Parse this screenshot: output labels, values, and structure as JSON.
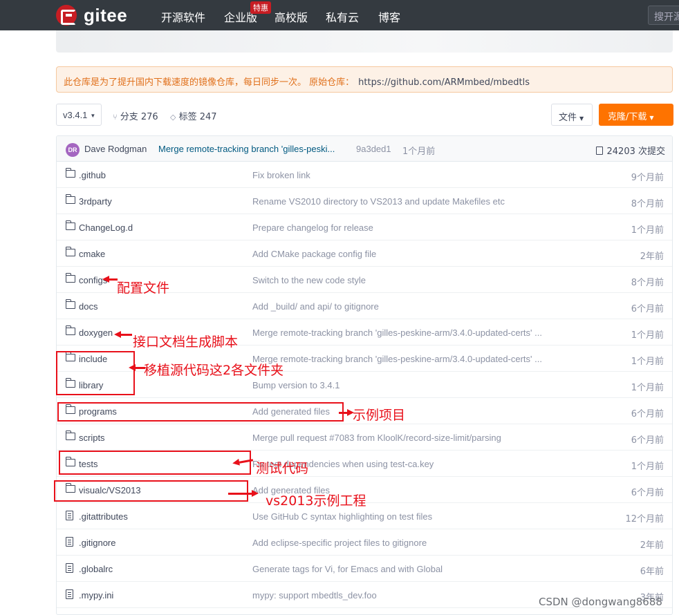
{
  "nav": {
    "logo_text": "gitee",
    "items": [
      "开源软件",
      "企业版",
      "高校版",
      "私有云",
      "博客"
    ],
    "badge": "特惠",
    "search_placeholder": "搜开源"
  },
  "notice": {
    "text": "此仓库是为了提升国内下载速度的镜像仓库，每日同步一次。 原始仓库：",
    "url": "https://github.com/ARMmbed/mbedtls"
  },
  "toolbar": {
    "version": "v3.4.1",
    "branches": "分支 276",
    "tags": "标签 247",
    "file_button": "文件",
    "clone_button": "克隆/下载"
  },
  "last_commit": {
    "avatar": "DR",
    "author": "Dave Rodgman",
    "message": "Merge remote-tracking branch 'gilles-peski...",
    "sha": "9a3ded1",
    "time": "1个月前",
    "count": "24203 次提交"
  },
  "files": [
    {
      "type": "folder",
      "name": ".github",
      "message": "Fix broken link",
      "time": "9个月前"
    },
    {
      "type": "folder",
      "name": "3rdparty",
      "message": "Rename VS2010 directory to VS2013 and update Makefiles etc",
      "time": "8个月前"
    },
    {
      "type": "folder",
      "name": "ChangeLog.d",
      "message": "Prepare changelog for release",
      "time": "1个月前"
    },
    {
      "type": "folder",
      "name": "cmake",
      "message": "Add CMake package config file",
      "time": "2年前"
    },
    {
      "type": "folder",
      "name": "configs",
      "message": "Switch to the new code style",
      "time": "8个月前"
    },
    {
      "type": "folder",
      "name": "docs",
      "message": "Add _build/ and api/ to gitignore",
      "time": "6个月前"
    },
    {
      "type": "folder",
      "name": "doxygen",
      "message": "Merge remote-tracking branch 'gilles-peskine-arm/3.4.0-updated-certs' ...",
      "time": "1个月前"
    },
    {
      "type": "folder",
      "name": "include",
      "message": "Merge remote-tracking branch 'gilles-peskine-arm/3.4.0-updated-certs' ...",
      "time": "1个月前"
    },
    {
      "type": "folder",
      "name": "library",
      "message": "Bump version to 3.4.1",
      "time": "1个月前"
    },
    {
      "type": "folder",
      "name": "programs",
      "message": "Add generated files",
      "time": "6个月前"
    },
    {
      "type": "folder",
      "name": "scripts",
      "message": "Merge pull request #7083 from KloolK/record-size-limit/parsing",
      "time": "6个月前"
    },
    {
      "type": "folder",
      "name": "tests",
      "message": "Fix test dependencies when using test-ca.key",
      "time": "1个月前"
    },
    {
      "type": "folder",
      "name": "visualc/VS2013",
      "message": "Add generated files",
      "time": "6个月前"
    },
    {
      "type": "file",
      "name": ".gitattributes",
      "message": "Use GitHub C syntax highlighting on test files",
      "time": "12个月前"
    },
    {
      "type": "file",
      "name": ".gitignore",
      "message": "Add eclipse-specific project files to gitignore",
      "time": "2年前"
    },
    {
      "type": "file",
      "name": ".globalrc",
      "message": "Generate tags for Vi, for Emacs and with Global",
      "time": "6年前"
    },
    {
      "type": "file",
      "name": ".mypy.ini",
      "message": "mypy: support mbedtls_dev.foo",
      "time": "3年前"
    }
  ],
  "annotations": {
    "configs": "配置文件",
    "doxygen": "接口文档生成脚本",
    "include_library": "移植源代码这2各文件夹",
    "programs": "示例项目",
    "tests": "测试代码",
    "visualc": "vs2013示例工程"
  },
  "watermark": "CSDN @dongwang8688",
  "colors": {
    "nav_bg": "#343a40",
    "brand": "#c71d23",
    "clone_button": "#fe7300",
    "annotation": "#e8101a",
    "notice_bg": "#fdf1e6"
  }
}
